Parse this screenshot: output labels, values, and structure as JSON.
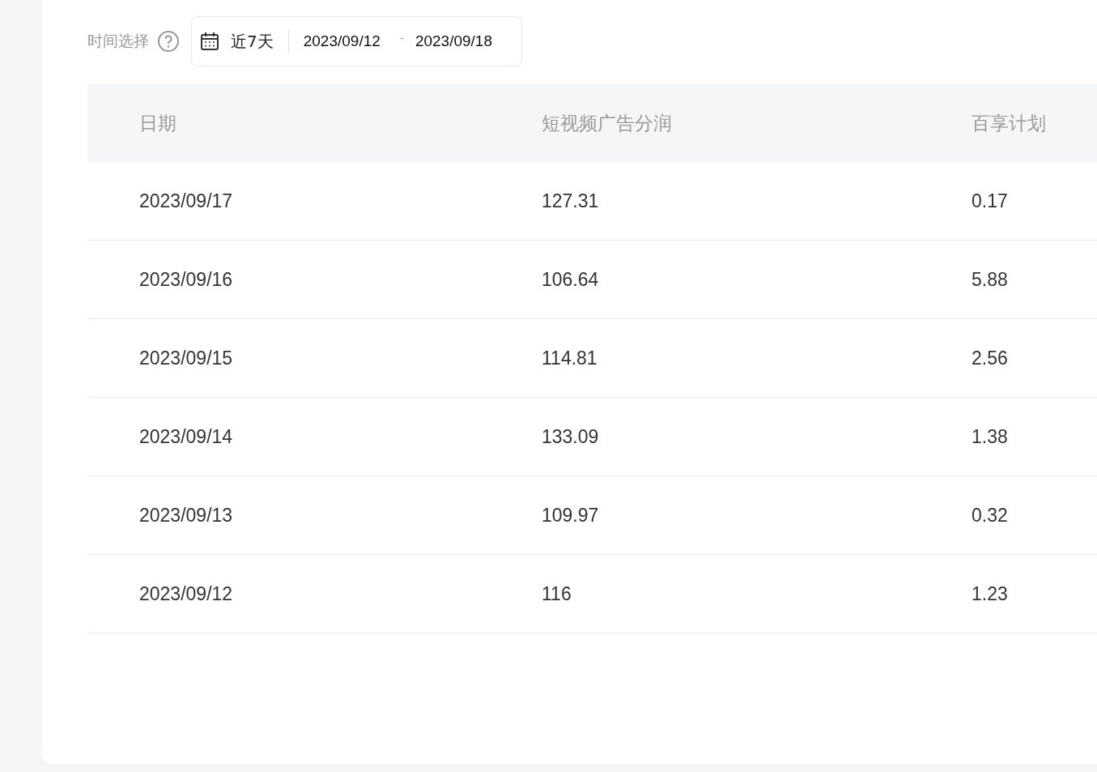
{
  "filter": {
    "label": "时间选择",
    "preset": "近7天",
    "start": "2023/09/12",
    "separator": "-",
    "end": "2023/09/18"
  },
  "table": {
    "columns": [
      "日期",
      "短视频广告分润",
      "百享计划"
    ],
    "rows": [
      [
        "2023/09/17",
        "127.31",
        "0.17"
      ],
      [
        "2023/09/16",
        "106.64",
        "5.88"
      ],
      [
        "2023/09/15",
        "114.81",
        "2.56"
      ],
      [
        "2023/09/14",
        "133.09",
        "1.38"
      ],
      [
        "2023/09/13",
        "109.97",
        "0.32"
      ],
      [
        "2023/09/12",
        "116",
        "1.23"
      ]
    ]
  }
}
